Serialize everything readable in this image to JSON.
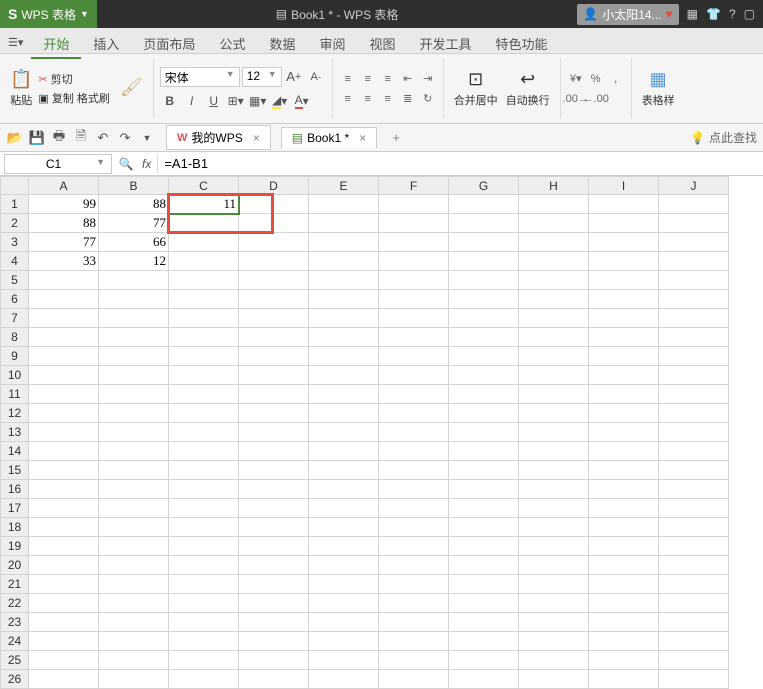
{
  "title_bar": {
    "app_name": "WPS 表格",
    "doc_title": "Book1 * - WPS 表格",
    "user_name": "小太阳14..."
  },
  "menu_tabs": {
    "items": [
      "开始",
      "插入",
      "页面布局",
      "公式",
      "数据",
      "审阅",
      "视图",
      "开发工具",
      "特色功能"
    ],
    "active": "开始"
  },
  "ribbon": {
    "paste": "粘贴",
    "cut": "剪切",
    "copy": "复制",
    "format_painter": "格式刷",
    "font_name": "宋体",
    "font_size": "12",
    "merge_center": "合并居中",
    "auto_wrap": "自动换行",
    "table_style": "表格样"
  },
  "doc_tabs": {
    "wps": "我的WPS",
    "book": "Book1 *"
  },
  "status_hint": "点此查找",
  "formula_bar": {
    "cell_ref": "C1",
    "fx": "fx",
    "formula": "=A1-B1"
  },
  "grid": {
    "columns": [
      "A",
      "B",
      "C",
      "D",
      "E",
      "F",
      "G",
      "H",
      "I",
      "J"
    ],
    "rows": 26,
    "data": {
      "1": {
        "A": "99",
        "B": "88",
        "C": "11"
      },
      "2": {
        "A": "88",
        "B": "77"
      },
      "3": {
        "A": "77",
        "B": "66"
      },
      "4": {
        "A": "33",
        "B": "12"
      }
    },
    "active_cell": "C1"
  },
  "chart_data": {
    "type": "table",
    "columns": [
      "A",
      "B",
      "C"
    ],
    "rows": [
      [
        99,
        88,
        11
      ],
      [
        88,
        77,
        null
      ],
      [
        77,
        66,
        null
      ],
      [
        33,
        12,
        null
      ]
    ],
    "note": "C1 = A1 - B1"
  }
}
